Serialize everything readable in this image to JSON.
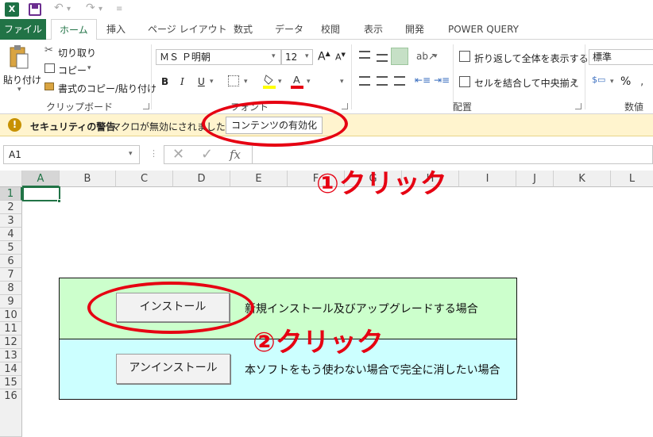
{
  "quick_access": {
    "app_icon": "excel-icon",
    "save_icon": "save-icon",
    "undo_icon": "undo-icon",
    "redo_icon": "redo-icon"
  },
  "tabs": {
    "file": "ファイル",
    "items": [
      "ホーム",
      "挿入",
      "ページ レイアウト",
      "数式",
      "データ",
      "校閲",
      "表示",
      "開発",
      "POWER QUERY"
    ],
    "active": "ホーム"
  },
  "ribbon": {
    "clipboard": {
      "paste": "貼り付け",
      "cut": "切り取り",
      "copy": "コピー",
      "format_painter": "書式のコピー/貼り付け",
      "label": "クリップボード"
    },
    "font": {
      "name": "ＭＳ Ｐ明朝",
      "size": "12",
      "bold": "B",
      "italic": "I",
      "underline": "U",
      "label": "フォント"
    },
    "alignment": {
      "wrap": "折り返して全体を表示する",
      "merge": "セルを結合して中央揃え",
      "label": "配置"
    },
    "number": {
      "format": "標準",
      "percent": "%",
      "label": "数値"
    }
  },
  "security_bar": {
    "title": "セキュリティの警告",
    "message": "マクロが無効にされました。",
    "button": "コンテンツの有効化"
  },
  "formula_bar": {
    "name_box": "A1",
    "fx": "fx"
  },
  "grid": {
    "columns": [
      "A",
      "B",
      "C",
      "D",
      "E",
      "F",
      "G",
      "H",
      "I",
      "J",
      "K",
      "L"
    ],
    "rows": [
      "1",
      "2",
      "3",
      "4",
      "5",
      "6",
      "7",
      "8",
      "9",
      "10",
      "11",
      "12",
      "13",
      "14",
      "15",
      "16"
    ]
  },
  "sheet": {
    "install_button": "インストール",
    "install_desc": "新規インストール及びアップグレードする場合",
    "uninstall_button": "アンインストール",
    "uninstall_desc": "本ソフトをもう使わない場合で完全に消したい場合"
  },
  "annotations": {
    "step1": "①クリック",
    "step2": "②クリック"
  },
  "colors": {
    "excel_green": "#217346",
    "install_bg": "#ccffcc",
    "uninstall_bg": "#ccffff",
    "annotation_red": "#e60012",
    "warning_bar": "#fff4ce"
  }
}
